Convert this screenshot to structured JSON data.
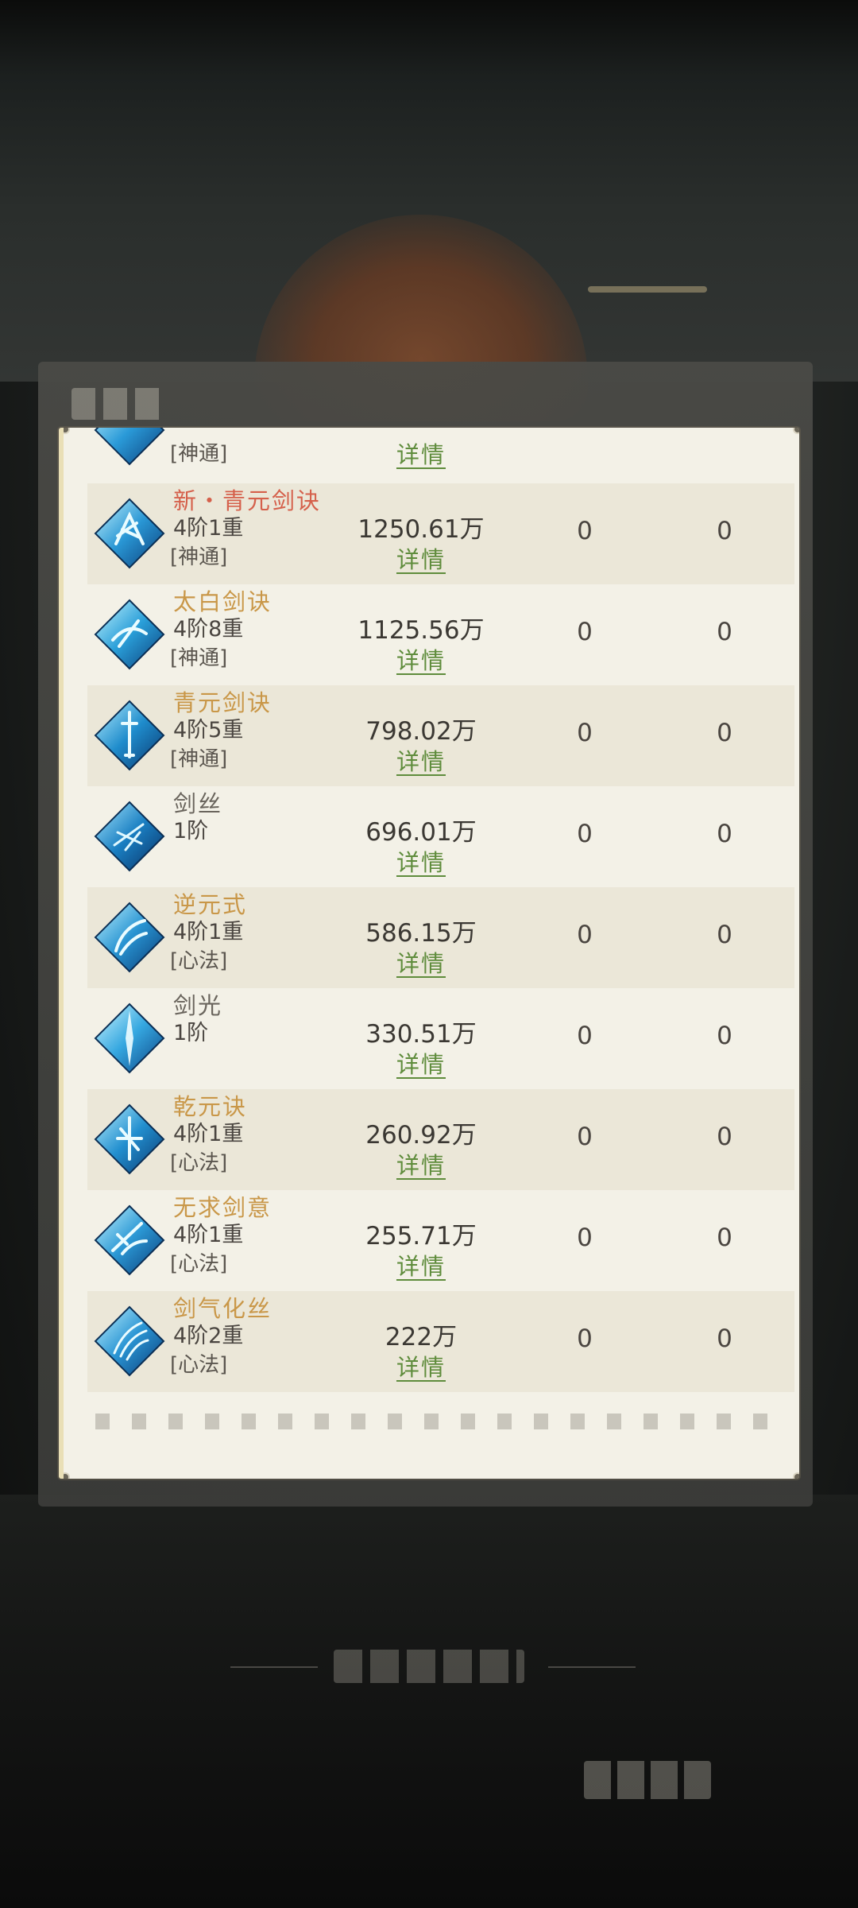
{
  "rows": [
    {
      "name": "",
      "tier": "",
      "type": "[神通]",
      "value": "",
      "detail": "详情",
      "col1": "",
      "col2": "",
      "name_color": "",
      "icon": "skill-icon"
    },
    {
      "name": "新・青元剑诀",
      "tier": "4阶1重",
      "type": "[神通]",
      "value": "1250.61万",
      "detail": "详情",
      "col1": "0",
      "col2": "0",
      "name_color": "#d5604b",
      "icon": "skill-icon"
    },
    {
      "name": "太白剑诀",
      "tier": "4阶8重",
      "type": "[神通]",
      "value": "1125.56万",
      "detail": "详情",
      "col1": "0",
      "col2": "0",
      "name_color": "#c99748",
      "icon": "skill-icon"
    },
    {
      "name": "青元剑诀",
      "tier": "4阶5重",
      "type": "[神通]",
      "value": "798.02万",
      "detail": "详情",
      "col1": "0",
      "col2": "0",
      "name_color": "#c99748",
      "icon": "skill-icon"
    },
    {
      "name": "剑丝",
      "tier": "1阶",
      "type": "",
      "value": "696.01万",
      "detail": "详情",
      "col1": "0",
      "col2": "0",
      "name_color": "#6a655d",
      "icon": "skill-icon"
    },
    {
      "name": "逆元式",
      "tier": "4阶1重",
      "type": "[心法]",
      "value": "586.15万",
      "detail": "详情",
      "col1": "0",
      "col2": "0",
      "name_color": "#c99748",
      "icon": "skill-icon"
    },
    {
      "name": "剑光",
      "tier": "1阶",
      "type": "",
      "value": "330.51万",
      "detail": "详情",
      "col1": "0",
      "col2": "0",
      "name_color": "#6a655d",
      "icon": "skill-icon"
    },
    {
      "name": "乾元诀",
      "tier": "4阶1重",
      "type": "[心法]",
      "value": "260.92万",
      "detail": "详情",
      "col1": "0",
      "col2": "0",
      "name_color": "#c99748",
      "icon": "skill-icon"
    },
    {
      "name": "无求剑意",
      "tier": "4阶1重",
      "type": "[心法]",
      "value": "255.71万",
      "detail": "详情",
      "col1": "0",
      "col2": "0",
      "name_color": "#c99748",
      "icon": "skill-icon"
    },
    {
      "name": "剑气化丝",
      "tier": "4阶2重",
      "type": "[心法]",
      "value": "222万",
      "detail": "详情",
      "col1": "0",
      "col2": "0",
      "name_color": "#c99748",
      "icon": "skill-icon"
    }
  ],
  "colors": {
    "panel_bg": "#f3f1e7",
    "row_alt_bg": "#ebe7d8",
    "detail_link": "#5f8c3c",
    "name_red": "#d5604b",
    "name_gold": "#c99748",
    "name_gray": "#6a655d"
  }
}
